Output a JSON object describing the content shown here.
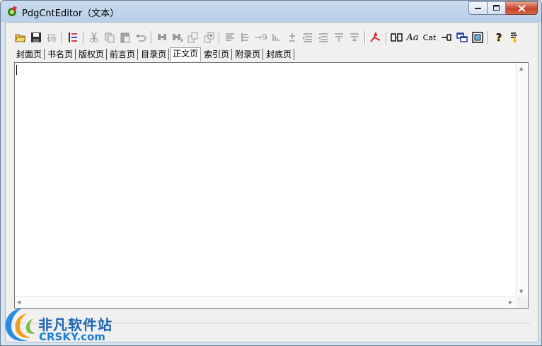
{
  "window": {
    "title": "PdgCntEditor（文本）",
    "accent": "#c7432a"
  },
  "toolbar": {
    "items": [
      {
        "icon": "open-folder-icon"
      },
      {
        "icon": "save-icon"
      },
      {
        "icon": "code-icon",
        "label": "码"
      },
      {
        "icon": "outline-icon"
      },
      {
        "icon": "cut-icon"
      },
      {
        "icon": "copy-icon"
      },
      {
        "icon": "paste-icon"
      },
      {
        "icon": "undo-icon"
      },
      {
        "icon": "find-icon"
      },
      {
        "icon": "find-next-icon"
      },
      {
        "icon": "replace-icon"
      },
      {
        "icon": "replace-all-icon"
      },
      {
        "icon": "align-left-icon"
      },
      {
        "icon": "indent-icon"
      },
      {
        "icon": "page-number-icon",
        "label": "9"
      },
      {
        "icon": "numbering-icon"
      },
      {
        "icon": "plus-minus-icon"
      },
      {
        "icon": "move-up-icon"
      },
      {
        "icon": "move-down-icon"
      },
      {
        "icon": "collapse-icon"
      },
      {
        "icon": "expand-icon"
      },
      {
        "icon": "pdf-icon"
      },
      {
        "icon": "columns-icon"
      },
      {
        "icon": "font-icon",
        "label": "Aa"
      },
      {
        "icon": "cat-icon",
        "label": "Cat"
      },
      {
        "icon": "pin-icon"
      },
      {
        "icon": "window-icon"
      },
      {
        "icon": "preview-icon"
      },
      {
        "icon": "help-icon",
        "label": "?"
      },
      {
        "icon": "about-icon"
      }
    ]
  },
  "tabs": [
    "封面页",
    "书名页",
    "版权页",
    "前言页",
    "目录页",
    "正文页",
    "索引页",
    "附录页",
    "封底页"
  ],
  "active_tab": "正文页",
  "editor": {
    "text": ""
  },
  "watermark": {
    "cn": "非凡软件站",
    "en": "CRSKY.com"
  }
}
